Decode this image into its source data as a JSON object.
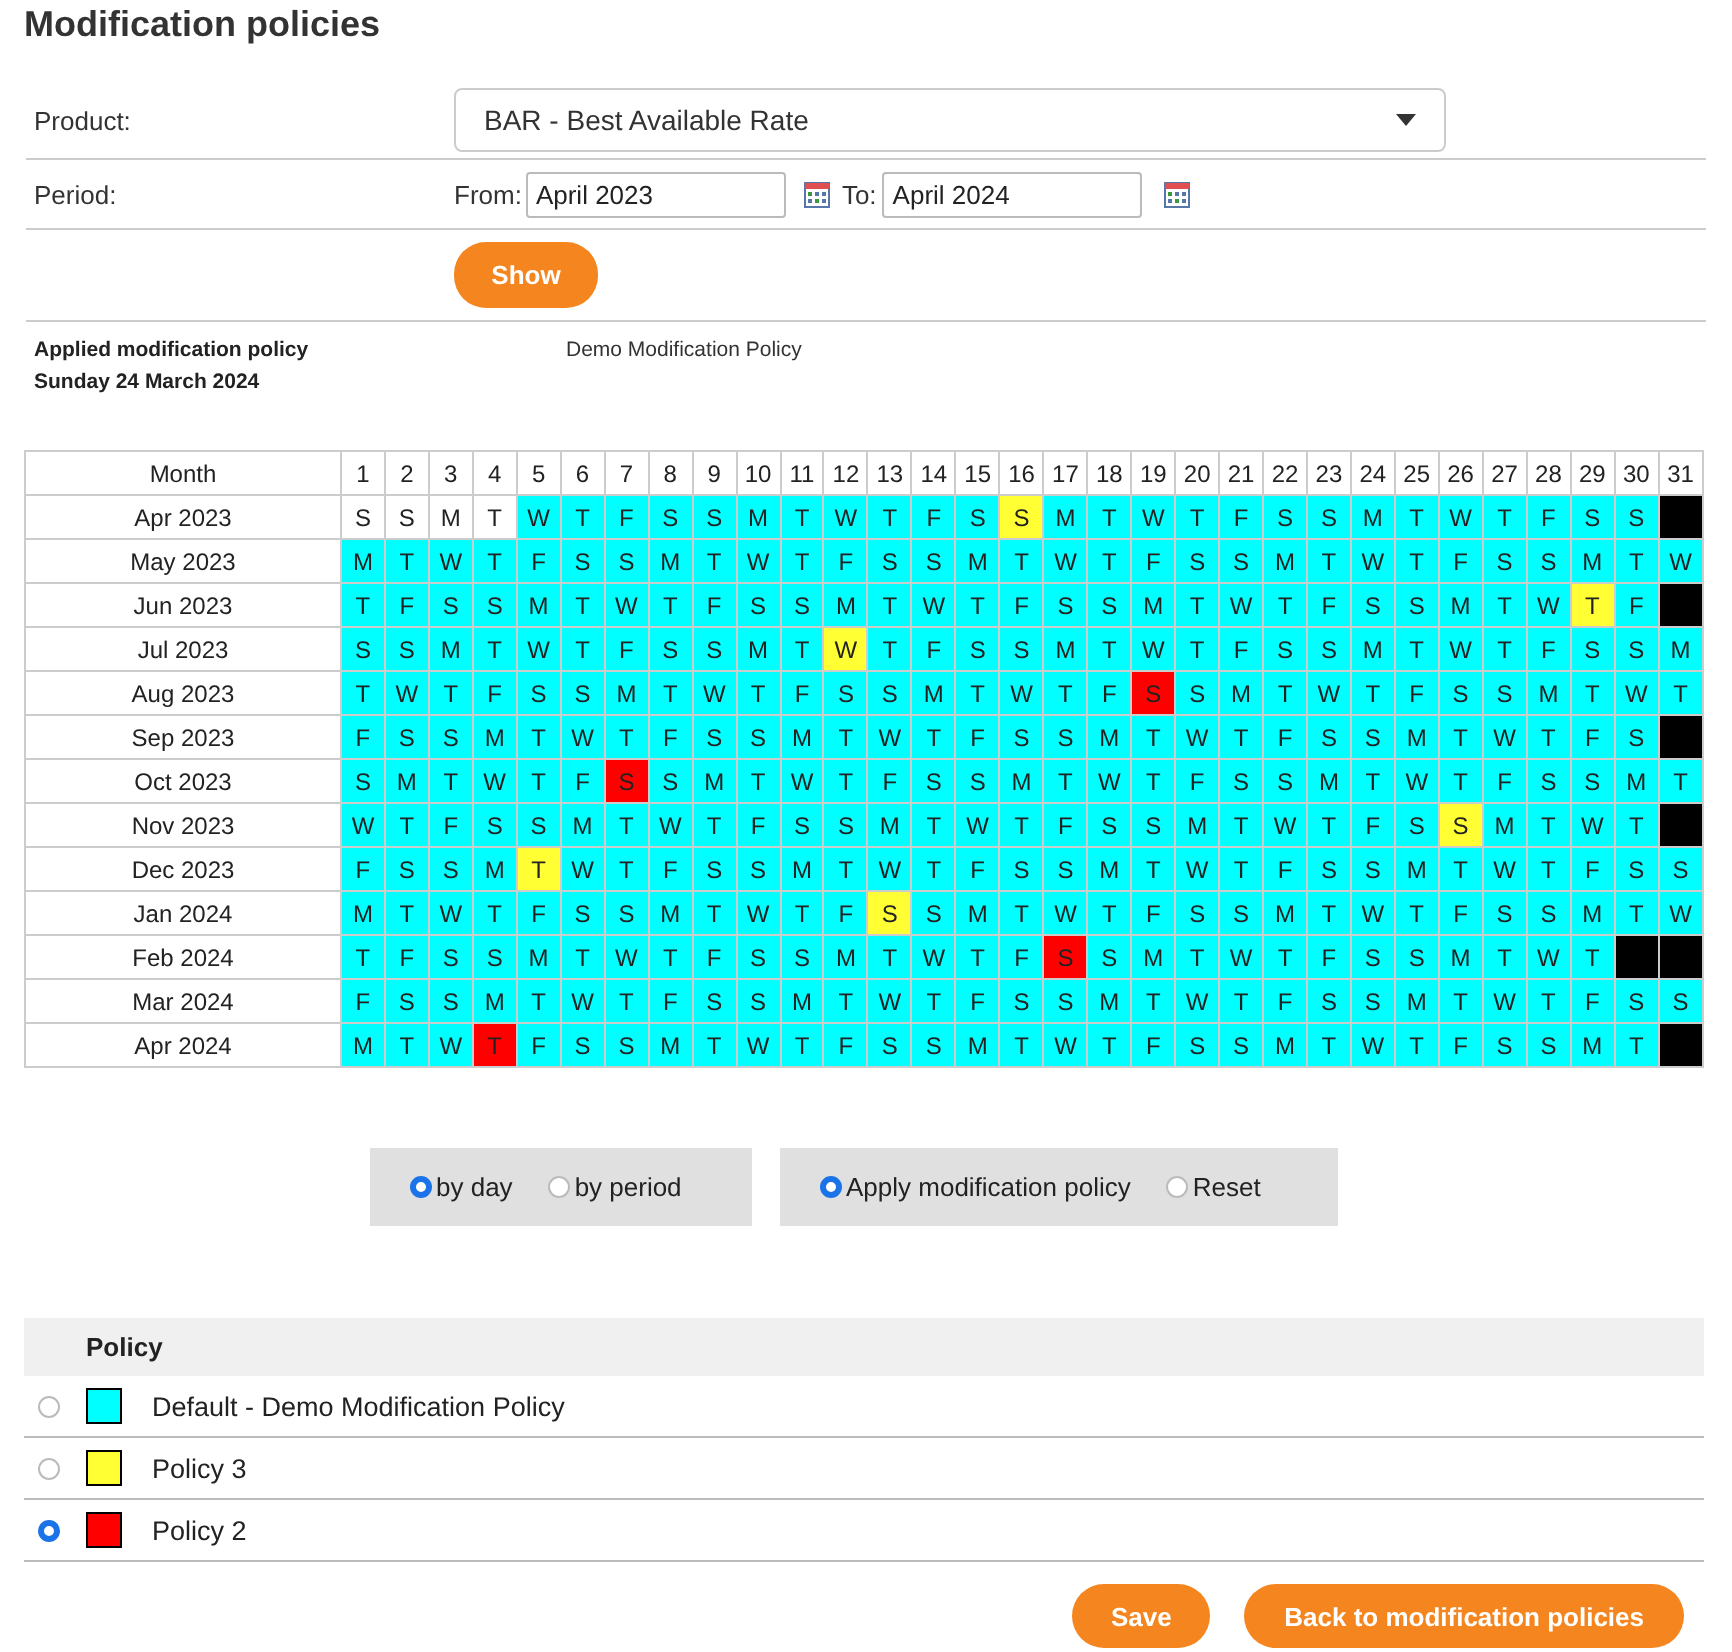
{
  "title": "Modification policies",
  "form": {
    "product_label": "Product:",
    "product": "BAR - Best Available Rate",
    "period_label": "Period:",
    "from_label": "From:",
    "from": "April 2023",
    "to_label": "To:",
    "to": "April 2024",
    "show_button": "Show"
  },
  "applied": {
    "label": "Applied modification policy",
    "date": "Sunday 24 March 2024",
    "policy": "Demo Modification Policy"
  },
  "calendar": {
    "month_header": "Month",
    "day_headers": [
      "1",
      "2",
      "3",
      "4",
      "5",
      "6",
      "7",
      "8",
      "9",
      "10",
      "11",
      "12",
      "13",
      "14",
      "15",
      "16",
      "17",
      "18",
      "19",
      "20",
      "21",
      "22",
      "23",
      "24",
      "25",
      "26",
      "27",
      "28",
      "29",
      "30",
      "31"
    ],
    "rows": [
      {
        "month": "Apr 2023",
        "cells": [
          {
            "letter": "S",
            "color": "#ffffff"
          },
          {
            "letter": "S",
            "color": "#ffffff"
          },
          {
            "letter": "M",
            "color": "#ffffff"
          },
          {
            "letter": "T",
            "color": "#ffffff"
          },
          {
            "letter": "W",
            "color": "#00ffff"
          },
          {
            "letter": "T",
            "color": "#00ffff"
          },
          {
            "letter": "F",
            "color": "#00ffff"
          },
          {
            "letter": "S",
            "color": "#00ffff"
          },
          {
            "letter": "S",
            "color": "#00ffff"
          },
          {
            "letter": "M",
            "color": "#00ffff"
          },
          {
            "letter": "T",
            "color": "#00ffff"
          },
          {
            "letter": "W",
            "color": "#00ffff"
          },
          {
            "letter": "T",
            "color": "#00ffff"
          },
          {
            "letter": "F",
            "color": "#00ffff"
          },
          {
            "letter": "S",
            "color": "#00ffff"
          },
          {
            "letter": "S",
            "color": "#ffff33"
          },
          {
            "letter": "M",
            "color": "#00ffff"
          },
          {
            "letter": "T",
            "color": "#00ffff"
          },
          {
            "letter": "W",
            "color": "#00ffff"
          },
          {
            "letter": "T",
            "color": "#00ffff"
          },
          {
            "letter": "F",
            "color": "#00ffff"
          },
          {
            "letter": "S",
            "color": "#00ffff"
          },
          {
            "letter": "S",
            "color": "#00ffff"
          },
          {
            "letter": "M",
            "color": "#00ffff"
          },
          {
            "letter": "T",
            "color": "#00ffff"
          },
          {
            "letter": "W",
            "color": "#00ffff"
          },
          {
            "letter": "T",
            "color": "#00ffff"
          },
          {
            "letter": "F",
            "color": "#00ffff"
          },
          {
            "letter": "S",
            "color": "#00ffff"
          },
          {
            "letter": "S",
            "color": "#00ffff"
          },
          {
            "color": "#000000"
          }
        ]
      },
      {
        "month": "May 2023",
        "cells": [
          {
            "letter": "M",
            "color": "#00ffff"
          },
          {
            "letter": "T",
            "color": "#00ffff"
          },
          {
            "letter": "W",
            "color": "#00ffff"
          },
          {
            "letter": "T",
            "color": "#00ffff"
          },
          {
            "letter": "F",
            "color": "#00ffff"
          },
          {
            "letter": "S",
            "color": "#00ffff"
          },
          {
            "letter": "S",
            "color": "#00ffff"
          },
          {
            "letter": "M",
            "color": "#00ffff"
          },
          {
            "letter": "T",
            "color": "#00ffff"
          },
          {
            "letter": "W",
            "color": "#00ffff"
          },
          {
            "letter": "T",
            "color": "#00ffff"
          },
          {
            "letter": "F",
            "color": "#00ffff"
          },
          {
            "letter": "S",
            "color": "#00ffff"
          },
          {
            "letter": "S",
            "color": "#00ffff"
          },
          {
            "letter": "M",
            "color": "#00ffff"
          },
          {
            "letter": "T",
            "color": "#00ffff"
          },
          {
            "letter": "W",
            "color": "#00ffff"
          },
          {
            "letter": "T",
            "color": "#00ffff"
          },
          {
            "letter": "F",
            "color": "#00ffff"
          },
          {
            "letter": "S",
            "color": "#00ffff"
          },
          {
            "letter": "S",
            "color": "#00ffff"
          },
          {
            "letter": "M",
            "color": "#00ffff"
          },
          {
            "letter": "T",
            "color": "#00ffff"
          },
          {
            "letter": "W",
            "color": "#00ffff"
          },
          {
            "letter": "T",
            "color": "#00ffff"
          },
          {
            "letter": "F",
            "color": "#00ffff"
          },
          {
            "letter": "S",
            "color": "#00ffff"
          },
          {
            "letter": "S",
            "color": "#00ffff"
          },
          {
            "letter": "M",
            "color": "#00ffff"
          },
          {
            "letter": "T",
            "color": "#00ffff"
          },
          {
            "letter": "W",
            "color": "#00ffff"
          }
        ]
      },
      {
        "month": "Jun 2023",
        "cells": [
          {
            "letter": "T",
            "color": "#00ffff"
          },
          {
            "letter": "F",
            "color": "#00ffff"
          },
          {
            "letter": "S",
            "color": "#00ffff"
          },
          {
            "letter": "S",
            "color": "#00ffff"
          },
          {
            "letter": "M",
            "color": "#00ffff"
          },
          {
            "letter": "T",
            "color": "#00ffff"
          },
          {
            "letter": "W",
            "color": "#00ffff"
          },
          {
            "letter": "T",
            "color": "#00ffff"
          },
          {
            "letter": "F",
            "color": "#00ffff"
          },
          {
            "letter": "S",
            "color": "#00ffff"
          },
          {
            "letter": "S",
            "color": "#00ffff"
          },
          {
            "letter": "M",
            "color": "#00ffff"
          },
          {
            "letter": "T",
            "color": "#00ffff"
          },
          {
            "letter": "W",
            "color": "#00ffff"
          },
          {
            "letter": "T",
            "color": "#00ffff"
          },
          {
            "letter": "F",
            "color": "#00ffff"
          },
          {
            "letter": "S",
            "color": "#00ffff"
          },
          {
            "letter": "S",
            "color": "#00ffff"
          },
          {
            "letter": "M",
            "color": "#00ffff"
          },
          {
            "letter": "T",
            "color": "#00ffff"
          },
          {
            "letter": "W",
            "color": "#00ffff"
          },
          {
            "letter": "T",
            "color": "#00ffff"
          },
          {
            "letter": "F",
            "color": "#00ffff"
          },
          {
            "letter": "S",
            "color": "#00ffff"
          },
          {
            "letter": "S",
            "color": "#00ffff"
          },
          {
            "letter": "M",
            "color": "#00ffff"
          },
          {
            "letter": "T",
            "color": "#00ffff"
          },
          {
            "letter": "W",
            "color": "#00ffff"
          },
          {
            "letter": "T",
            "color": "#ffff33"
          },
          {
            "letter": "F",
            "color": "#00ffff"
          },
          {
            "color": "#000000"
          }
        ]
      },
      {
        "month": "Jul 2023",
        "cells": [
          {
            "letter": "S",
            "color": "#00ffff"
          },
          {
            "letter": "S",
            "color": "#00ffff"
          },
          {
            "letter": "M",
            "color": "#00ffff"
          },
          {
            "letter": "T",
            "color": "#00ffff"
          },
          {
            "letter": "W",
            "color": "#00ffff"
          },
          {
            "letter": "T",
            "color": "#00ffff"
          },
          {
            "letter": "F",
            "color": "#00ffff"
          },
          {
            "letter": "S",
            "color": "#00ffff"
          },
          {
            "letter": "S",
            "color": "#00ffff"
          },
          {
            "letter": "M",
            "color": "#00ffff"
          },
          {
            "letter": "T",
            "color": "#00ffff"
          },
          {
            "letter": "W",
            "color": "#ffff33"
          },
          {
            "letter": "T",
            "color": "#00ffff"
          },
          {
            "letter": "F",
            "color": "#00ffff"
          },
          {
            "letter": "S",
            "color": "#00ffff"
          },
          {
            "letter": "S",
            "color": "#00ffff"
          },
          {
            "letter": "M",
            "color": "#00ffff"
          },
          {
            "letter": "T",
            "color": "#00ffff"
          },
          {
            "letter": "W",
            "color": "#00ffff"
          },
          {
            "letter": "T",
            "color": "#00ffff"
          },
          {
            "letter": "F",
            "color": "#00ffff"
          },
          {
            "letter": "S",
            "color": "#00ffff"
          },
          {
            "letter": "S",
            "color": "#00ffff"
          },
          {
            "letter": "M",
            "color": "#00ffff"
          },
          {
            "letter": "T",
            "color": "#00ffff"
          },
          {
            "letter": "W",
            "color": "#00ffff"
          },
          {
            "letter": "T",
            "color": "#00ffff"
          },
          {
            "letter": "F",
            "color": "#00ffff"
          },
          {
            "letter": "S",
            "color": "#00ffff"
          },
          {
            "letter": "S",
            "color": "#00ffff"
          },
          {
            "letter": "M",
            "color": "#00ffff"
          }
        ]
      },
      {
        "month": "Aug 2023",
        "cells": [
          {
            "letter": "T",
            "color": "#00ffff"
          },
          {
            "letter": "W",
            "color": "#00ffff"
          },
          {
            "letter": "T",
            "color": "#00ffff"
          },
          {
            "letter": "F",
            "color": "#00ffff"
          },
          {
            "letter": "S",
            "color": "#00ffff"
          },
          {
            "letter": "S",
            "color": "#00ffff"
          },
          {
            "letter": "M",
            "color": "#00ffff"
          },
          {
            "letter": "T",
            "color": "#00ffff"
          },
          {
            "letter": "W",
            "color": "#00ffff"
          },
          {
            "letter": "T",
            "color": "#00ffff"
          },
          {
            "letter": "F",
            "color": "#00ffff"
          },
          {
            "letter": "S",
            "color": "#00ffff"
          },
          {
            "letter": "S",
            "color": "#00ffff"
          },
          {
            "letter": "M",
            "color": "#00ffff"
          },
          {
            "letter": "T",
            "color": "#00ffff"
          },
          {
            "letter": "W",
            "color": "#00ffff"
          },
          {
            "letter": "T",
            "color": "#00ffff"
          },
          {
            "letter": "F",
            "color": "#00ffff"
          },
          {
            "letter": "S",
            "color": "#ff0000"
          },
          {
            "letter": "S",
            "color": "#00ffff"
          },
          {
            "letter": "M",
            "color": "#00ffff"
          },
          {
            "letter": "T",
            "color": "#00ffff"
          },
          {
            "letter": "W",
            "color": "#00ffff"
          },
          {
            "letter": "T",
            "color": "#00ffff"
          },
          {
            "letter": "F",
            "color": "#00ffff"
          },
          {
            "letter": "S",
            "color": "#00ffff"
          },
          {
            "letter": "S",
            "color": "#00ffff"
          },
          {
            "letter": "M",
            "color": "#00ffff"
          },
          {
            "letter": "T",
            "color": "#00ffff"
          },
          {
            "letter": "W",
            "color": "#00ffff"
          },
          {
            "letter": "T",
            "color": "#00ffff"
          }
        ]
      },
      {
        "month": "Sep 2023",
        "cells": [
          {
            "letter": "F",
            "color": "#00ffff"
          },
          {
            "letter": "S",
            "color": "#00ffff"
          },
          {
            "letter": "S",
            "color": "#00ffff"
          },
          {
            "letter": "M",
            "color": "#00ffff"
          },
          {
            "letter": "T",
            "color": "#00ffff"
          },
          {
            "letter": "W",
            "color": "#00ffff"
          },
          {
            "letter": "T",
            "color": "#00ffff"
          },
          {
            "letter": "F",
            "color": "#00ffff"
          },
          {
            "letter": "S",
            "color": "#00ffff"
          },
          {
            "letter": "S",
            "color": "#00ffff"
          },
          {
            "letter": "M",
            "color": "#00ffff"
          },
          {
            "letter": "T",
            "color": "#00ffff"
          },
          {
            "letter": "W",
            "color": "#00ffff"
          },
          {
            "letter": "T",
            "color": "#00ffff"
          },
          {
            "letter": "F",
            "color": "#00ffff"
          },
          {
            "letter": "S",
            "color": "#00ffff"
          },
          {
            "letter": "S",
            "color": "#00ffff"
          },
          {
            "letter": "M",
            "color": "#00ffff"
          },
          {
            "letter": "T",
            "color": "#00ffff"
          },
          {
            "letter": "W",
            "color": "#00ffff"
          },
          {
            "letter": "T",
            "color": "#00ffff"
          },
          {
            "letter": "F",
            "color": "#00ffff"
          },
          {
            "letter": "S",
            "color": "#00ffff"
          },
          {
            "letter": "S",
            "color": "#00ffff"
          },
          {
            "letter": "M",
            "color": "#00ffff"
          },
          {
            "letter": "T",
            "color": "#00ffff"
          },
          {
            "letter": "W",
            "color": "#00ffff"
          },
          {
            "letter": "T",
            "color": "#00ffff"
          },
          {
            "letter": "F",
            "color": "#00ffff"
          },
          {
            "letter": "S",
            "color": "#00ffff"
          },
          {
            "color": "#000000"
          }
        ]
      },
      {
        "month": "Oct 2023",
        "cells": [
          {
            "letter": "S",
            "color": "#00ffff"
          },
          {
            "letter": "M",
            "color": "#00ffff"
          },
          {
            "letter": "T",
            "color": "#00ffff"
          },
          {
            "letter": "W",
            "color": "#00ffff"
          },
          {
            "letter": "T",
            "color": "#00ffff"
          },
          {
            "letter": "F",
            "color": "#00ffff"
          },
          {
            "letter": "S",
            "color": "#ff0000"
          },
          {
            "letter": "S",
            "color": "#00ffff"
          },
          {
            "letter": "M",
            "color": "#00ffff"
          },
          {
            "letter": "T",
            "color": "#00ffff"
          },
          {
            "letter": "W",
            "color": "#00ffff"
          },
          {
            "letter": "T",
            "color": "#00ffff"
          },
          {
            "letter": "F",
            "color": "#00ffff"
          },
          {
            "letter": "S",
            "color": "#00ffff"
          },
          {
            "letter": "S",
            "color": "#00ffff"
          },
          {
            "letter": "M",
            "color": "#00ffff"
          },
          {
            "letter": "T",
            "color": "#00ffff"
          },
          {
            "letter": "W",
            "color": "#00ffff"
          },
          {
            "letter": "T",
            "color": "#00ffff"
          },
          {
            "letter": "F",
            "color": "#00ffff"
          },
          {
            "letter": "S",
            "color": "#00ffff"
          },
          {
            "letter": "S",
            "color": "#00ffff"
          },
          {
            "letter": "M",
            "color": "#00ffff"
          },
          {
            "letter": "T",
            "color": "#00ffff"
          },
          {
            "letter": "W",
            "color": "#00ffff"
          },
          {
            "letter": "T",
            "color": "#00ffff"
          },
          {
            "letter": "F",
            "color": "#00ffff"
          },
          {
            "letter": "S",
            "color": "#00ffff"
          },
          {
            "letter": "S",
            "color": "#00ffff"
          },
          {
            "letter": "M",
            "color": "#00ffff"
          },
          {
            "letter": "T",
            "color": "#00ffff"
          }
        ]
      },
      {
        "month": "Nov 2023",
        "cells": [
          {
            "letter": "W",
            "color": "#00ffff"
          },
          {
            "letter": "T",
            "color": "#00ffff"
          },
          {
            "letter": "F",
            "color": "#00ffff"
          },
          {
            "letter": "S",
            "color": "#00ffff"
          },
          {
            "letter": "S",
            "color": "#00ffff"
          },
          {
            "letter": "M",
            "color": "#00ffff"
          },
          {
            "letter": "T",
            "color": "#00ffff"
          },
          {
            "letter": "W",
            "color": "#00ffff"
          },
          {
            "letter": "T",
            "color": "#00ffff"
          },
          {
            "letter": "F",
            "color": "#00ffff"
          },
          {
            "letter": "S",
            "color": "#00ffff"
          },
          {
            "letter": "S",
            "color": "#00ffff"
          },
          {
            "letter": "M",
            "color": "#00ffff"
          },
          {
            "letter": "T",
            "color": "#00ffff"
          },
          {
            "letter": "W",
            "color": "#00ffff"
          },
          {
            "letter": "T",
            "color": "#00ffff"
          },
          {
            "letter": "F",
            "color": "#00ffff"
          },
          {
            "letter": "S",
            "color": "#00ffff"
          },
          {
            "letter": "S",
            "color": "#00ffff"
          },
          {
            "letter": "M",
            "color": "#00ffff"
          },
          {
            "letter": "T",
            "color": "#00ffff"
          },
          {
            "letter": "W",
            "color": "#00ffff"
          },
          {
            "letter": "T",
            "color": "#00ffff"
          },
          {
            "letter": "F",
            "color": "#00ffff"
          },
          {
            "letter": "S",
            "color": "#00ffff"
          },
          {
            "letter": "S",
            "color": "#ffff33"
          },
          {
            "letter": "M",
            "color": "#00ffff"
          },
          {
            "letter": "T",
            "color": "#00ffff"
          },
          {
            "letter": "W",
            "color": "#00ffff"
          },
          {
            "letter": "T",
            "color": "#00ffff"
          },
          {
            "color": "#000000"
          }
        ]
      },
      {
        "month": "Dec 2023",
        "cells": [
          {
            "letter": "F",
            "color": "#00ffff"
          },
          {
            "letter": "S",
            "color": "#00ffff"
          },
          {
            "letter": "S",
            "color": "#00ffff"
          },
          {
            "letter": "M",
            "color": "#00ffff"
          },
          {
            "letter": "T",
            "color": "#ffff33"
          },
          {
            "letter": "W",
            "color": "#00ffff"
          },
          {
            "letter": "T",
            "color": "#00ffff"
          },
          {
            "letter": "F",
            "color": "#00ffff"
          },
          {
            "letter": "S",
            "color": "#00ffff"
          },
          {
            "letter": "S",
            "color": "#00ffff"
          },
          {
            "letter": "M",
            "color": "#00ffff"
          },
          {
            "letter": "T",
            "color": "#00ffff"
          },
          {
            "letter": "W",
            "color": "#00ffff"
          },
          {
            "letter": "T",
            "color": "#00ffff"
          },
          {
            "letter": "F",
            "color": "#00ffff"
          },
          {
            "letter": "S",
            "color": "#00ffff"
          },
          {
            "letter": "S",
            "color": "#00ffff"
          },
          {
            "letter": "M",
            "color": "#00ffff"
          },
          {
            "letter": "T",
            "color": "#00ffff"
          },
          {
            "letter": "W",
            "color": "#00ffff"
          },
          {
            "letter": "T",
            "color": "#00ffff"
          },
          {
            "letter": "F",
            "color": "#00ffff"
          },
          {
            "letter": "S",
            "color": "#00ffff"
          },
          {
            "letter": "S",
            "color": "#00ffff"
          },
          {
            "letter": "M",
            "color": "#00ffff"
          },
          {
            "letter": "T",
            "color": "#00ffff"
          },
          {
            "letter": "W",
            "color": "#00ffff"
          },
          {
            "letter": "T",
            "color": "#00ffff"
          },
          {
            "letter": "F",
            "color": "#00ffff"
          },
          {
            "letter": "S",
            "color": "#00ffff"
          },
          {
            "letter": "S",
            "color": "#00ffff"
          }
        ]
      },
      {
        "month": "Jan 2024",
        "cells": [
          {
            "letter": "M",
            "color": "#00ffff"
          },
          {
            "letter": "T",
            "color": "#00ffff"
          },
          {
            "letter": "W",
            "color": "#00ffff"
          },
          {
            "letter": "T",
            "color": "#00ffff"
          },
          {
            "letter": "F",
            "color": "#00ffff"
          },
          {
            "letter": "S",
            "color": "#00ffff"
          },
          {
            "letter": "S",
            "color": "#00ffff"
          },
          {
            "letter": "M",
            "color": "#00ffff"
          },
          {
            "letter": "T",
            "color": "#00ffff"
          },
          {
            "letter": "W",
            "color": "#00ffff"
          },
          {
            "letter": "T",
            "color": "#00ffff"
          },
          {
            "letter": "F",
            "color": "#00ffff"
          },
          {
            "letter": "S",
            "color": "#ffff33"
          },
          {
            "letter": "S",
            "color": "#00ffff"
          },
          {
            "letter": "M",
            "color": "#00ffff"
          },
          {
            "letter": "T",
            "color": "#00ffff"
          },
          {
            "letter": "W",
            "color": "#00ffff"
          },
          {
            "letter": "T",
            "color": "#00ffff"
          },
          {
            "letter": "F",
            "color": "#00ffff"
          },
          {
            "letter": "S",
            "color": "#00ffff"
          },
          {
            "letter": "S",
            "color": "#00ffff"
          },
          {
            "letter": "M",
            "color": "#00ffff"
          },
          {
            "letter": "T",
            "color": "#00ffff"
          },
          {
            "letter": "W",
            "color": "#00ffff"
          },
          {
            "letter": "T",
            "color": "#00ffff"
          },
          {
            "letter": "F",
            "color": "#00ffff"
          },
          {
            "letter": "S",
            "color": "#00ffff"
          },
          {
            "letter": "S",
            "color": "#00ffff"
          },
          {
            "letter": "M",
            "color": "#00ffff"
          },
          {
            "letter": "T",
            "color": "#00ffff"
          },
          {
            "letter": "W",
            "color": "#00ffff"
          }
        ]
      },
      {
        "month": "Feb 2024",
        "cells": [
          {
            "letter": "T",
            "color": "#00ffff"
          },
          {
            "letter": "F",
            "color": "#00ffff"
          },
          {
            "letter": "S",
            "color": "#00ffff"
          },
          {
            "letter": "S",
            "color": "#00ffff"
          },
          {
            "letter": "M",
            "color": "#00ffff"
          },
          {
            "letter": "T",
            "color": "#00ffff"
          },
          {
            "letter": "W",
            "color": "#00ffff"
          },
          {
            "letter": "T",
            "color": "#00ffff"
          },
          {
            "letter": "F",
            "color": "#00ffff"
          },
          {
            "letter": "S",
            "color": "#00ffff"
          },
          {
            "letter": "S",
            "color": "#00ffff"
          },
          {
            "letter": "M",
            "color": "#00ffff"
          },
          {
            "letter": "T",
            "color": "#00ffff"
          },
          {
            "letter": "W",
            "color": "#00ffff"
          },
          {
            "letter": "T",
            "color": "#00ffff"
          },
          {
            "letter": "F",
            "color": "#00ffff"
          },
          {
            "letter": "S",
            "color": "#ff0000"
          },
          {
            "letter": "S",
            "color": "#00ffff"
          },
          {
            "letter": "M",
            "color": "#00ffff"
          },
          {
            "letter": "T",
            "color": "#00ffff"
          },
          {
            "letter": "W",
            "color": "#00ffff"
          },
          {
            "letter": "T",
            "color": "#00ffff"
          },
          {
            "letter": "F",
            "color": "#00ffff"
          },
          {
            "letter": "S",
            "color": "#00ffff"
          },
          {
            "letter": "S",
            "color": "#00ffff"
          },
          {
            "letter": "M",
            "color": "#00ffff"
          },
          {
            "letter": "T",
            "color": "#00ffff"
          },
          {
            "letter": "W",
            "color": "#00ffff"
          },
          {
            "letter": "T",
            "color": "#00ffff"
          },
          {
            "color": "#000000"
          },
          {
            "color": "#000000"
          }
        ]
      },
      {
        "month": "Mar 2024",
        "cells": [
          {
            "letter": "F",
            "color": "#00ffff"
          },
          {
            "letter": "S",
            "color": "#00ffff"
          },
          {
            "letter": "S",
            "color": "#00ffff"
          },
          {
            "letter": "M",
            "color": "#00ffff"
          },
          {
            "letter": "T",
            "color": "#00ffff"
          },
          {
            "letter": "W",
            "color": "#00ffff"
          },
          {
            "letter": "T",
            "color": "#00ffff"
          },
          {
            "letter": "F",
            "color": "#00ffff"
          },
          {
            "letter": "S",
            "color": "#00ffff"
          },
          {
            "letter": "S",
            "color": "#00ffff"
          },
          {
            "letter": "M",
            "color": "#00ffff"
          },
          {
            "letter": "T",
            "color": "#00ffff"
          },
          {
            "letter": "W",
            "color": "#00ffff"
          },
          {
            "letter": "T",
            "color": "#00ffff"
          },
          {
            "letter": "F",
            "color": "#00ffff"
          },
          {
            "letter": "S",
            "color": "#00ffff"
          },
          {
            "letter": "S",
            "color": "#00ffff"
          },
          {
            "letter": "M",
            "color": "#00ffff"
          },
          {
            "letter": "T",
            "color": "#00ffff"
          },
          {
            "letter": "W",
            "color": "#00ffff"
          },
          {
            "letter": "T",
            "color": "#00ffff"
          },
          {
            "letter": "F",
            "color": "#00ffff"
          },
          {
            "letter": "S",
            "color": "#00ffff"
          },
          {
            "letter": "S",
            "color": "#00ffff"
          },
          {
            "letter": "M",
            "color": "#00ffff"
          },
          {
            "letter": "T",
            "color": "#00ffff"
          },
          {
            "letter": "W",
            "color": "#00ffff"
          },
          {
            "letter": "T",
            "color": "#00ffff"
          },
          {
            "letter": "F",
            "color": "#00ffff"
          },
          {
            "letter": "S",
            "color": "#00ffff"
          },
          {
            "letter": "S",
            "color": "#00ffff"
          }
        ]
      },
      {
        "month": "Apr 2024",
        "cells": [
          {
            "letter": "M",
            "color": "#00ffff"
          },
          {
            "letter": "T",
            "color": "#00ffff"
          },
          {
            "letter": "W",
            "color": "#00ffff"
          },
          {
            "letter": "T",
            "color": "#ff0000"
          },
          {
            "letter": "F",
            "color": "#00ffff"
          },
          {
            "letter": "S",
            "color": "#00ffff"
          },
          {
            "letter": "S",
            "color": "#00ffff"
          },
          {
            "letter": "M",
            "color": "#00ffff"
          },
          {
            "letter": "T",
            "color": "#00ffff"
          },
          {
            "letter": "W",
            "color": "#00ffff"
          },
          {
            "letter": "T",
            "color": "#00ffff"
          },
          {
            "letter": "F",
            "color": "#00ffff"
          },
          {
            "letter": "S",
            "color": "#00ffff"
          },
          {
            "letter": "S",
            "color": "#00ffff"
          },
          {
            "letter": "M",
            "color": "#00ffff"
          },
          {
            "letter": "T",
            "color": "#00ffff"
          },
          {
            "letter": "W",
            "color": "#00ffff"
          },
          {
            "letter": "T",
            "color": "#00ffff"
          },
          {
            "letter": "F",
            "color": "#00ffff"
          },
          {
            "letter": "S",
            "color": "#00ffff"
          },
          {
            "letter": "S",
            "color": "#00ffff"
          },
          {
            "letter": "M",
            "color": "#00ffff"
          },
          {
            "letter": "T",
            "color": "#00ffff"
          },
          {
            "letter": "W",
            "color": "#00ffff"
          },
          {
            "letter": "T",
            "color": "#00ffff"
          },
          {
            "letter": "F",
            "color": "#00ffff"
          },
          {
            "letter": "S",
            "color": "#00ffff"
          },
          {
            "letter": "S",
            "color": "#00ffff"
          },
          {
            "letter": "M",
            "color": "#00ffff"
          },
          {
            "letter": "T",
            "color": "#00ffff"
          },
          {
            "color": "#000000"
          }
        ]
      }
    ]
  },
  "mode_options": [
    {
      "label": "by day",
      "selected": true
    },
    {
      "label": "by period",
      "selected": false
    }
  ],
  "action_options": [
    {
      "label": "Apply modification policy",
      "selected": true
    },
    {
      "label": "Reset",
      "selected": false
    }
  ],
  "policies": {
    "header": "Policy",
    "items": [
      {
        "name": "Default - Demo Modification Policy",
        "color": "#00ffff",
        "selected": false
      },
      {
        "name": "Policy 3",
        "color": "#ffff33",
        "selected": false
      },
      {
        "name": "Policy 2",
        "color": "#ff0000",
        "selected": true
      }
    ]
  },
  "buttons": [
    "Save",
    "Back to modification policies"
  ]
}
